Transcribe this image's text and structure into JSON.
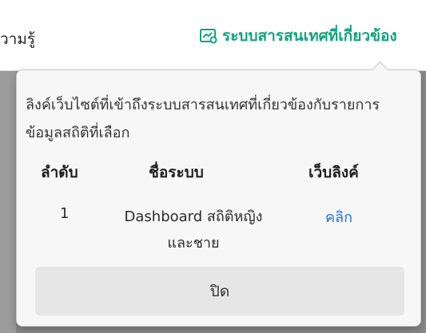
{
  "header": {
    "knowledge_tab_label": "วามรู้",
    "related_systems_label": "ระบบสารสนเทศที่เกี่ยวข้อง",
    "accent_color": "#10a37f",
    "related_systems_icon": "chart-link-icon"
  },
  "popover": {
    "description": "ลิงค์เว็บไซต์ที่เข้าถึงระบบสารสนเทศที่เกี่ยวข้องกับรายการข้อมูลสถิติที่เลือก",
    "columns": [
      "ลำดับ",
      "ชื่อระบบ",
      "เว็บลิงค์"
    ],
    "rows": [
      {
        "order": "1",
        "name": "Dashboard สถิติหญิงและชาย",
        "link_label": "คลิก"
      }
    ],
    "close_label": "ปิด",
    "link_color": "#1a73e8"
  }
}
